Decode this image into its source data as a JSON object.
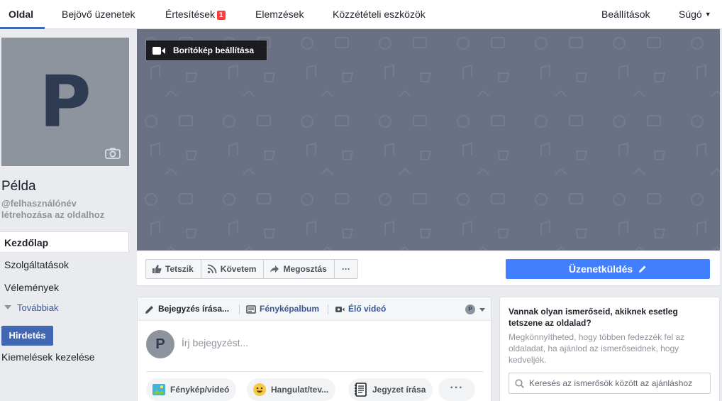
{
  "topnav": {
    "tabs": [
      {
        "label": "Oldal"
      },
      {
        "label": "Bejövő üzenetek"
      },
      {
        "label": "Értesítések",
        "badge": "1"
      },
      {
        "label": "Elemzések"
      },
      {
        "label": "Közzétételi eszközök"
      }
    ],
    "settings": "Beállítások",
    "help": "Súgó"
  },
  "sidebar": {
    "avatar_letter": "P",
    "page_name": "Példa",
    "username_line1": "@felhasználónév",
    "username_line2": "létrehozása az oldalhoz",
    "nav": [
      "Kezdőlap",
      "Szolgáltatások",
      "Vélemények"
    ],
    "more": "Továbbiak",
    "promote": "Hirdetés",
    "manage_promotions": "Kiemelések kezelése"
  },
  "cover": {
    "set_cover_label": "Borítókép beállítása",
    "color": "#6b7185"
  },
  "actions": {
    "like": "Tetszik",
    "follow": "Követem",
    "share": "Megosztás",
    "more": "···",
    "send_message": "Üzenetküldés",
    "accent": "#4080ff"
  },
  "composer": {
    "tabs": [
      "Bejegyzés írása...",
      "Fényképalbum",
      "Élő videó"
    ],
    "avatar_letter": "P",
    "placeholder": "Írj bejegyzést...",
    "buttons": [
      "Fénykép/videó",
      "Hangulat/tev...",
      "Jegyzet írása"
    ],
    "more": "···"
  },
  "invite": {
    "title": "Vannak olyan ismerőseid, akiknek esetleg tetszene az oldalad?",
    "text": "Megkönnyítheted, hogy többen fedezzék fel az oldaladat, ha ajánlod az ismerőseidnek, hogy kedveljék.",
    "search_placeholder": "Keresés az ismerősök között az ajánláshoz"
  },
  "icons": {
    "camera": "camera-icon",
    "video": "video-camera-icon",
    "like": "thumbs-up-icon",
    "follow": "rss-icon",
    "share": "share-arrow-icon",
    "pencil": "pencil-icon",
    "album": "photo-album-icon",
    "live": "live-video-icon",
    "photo": "photo-icon",
    "feeling": "smiley-icon",
    "note": "notebook-icon",
    "search": "search-icon"
  }
}
